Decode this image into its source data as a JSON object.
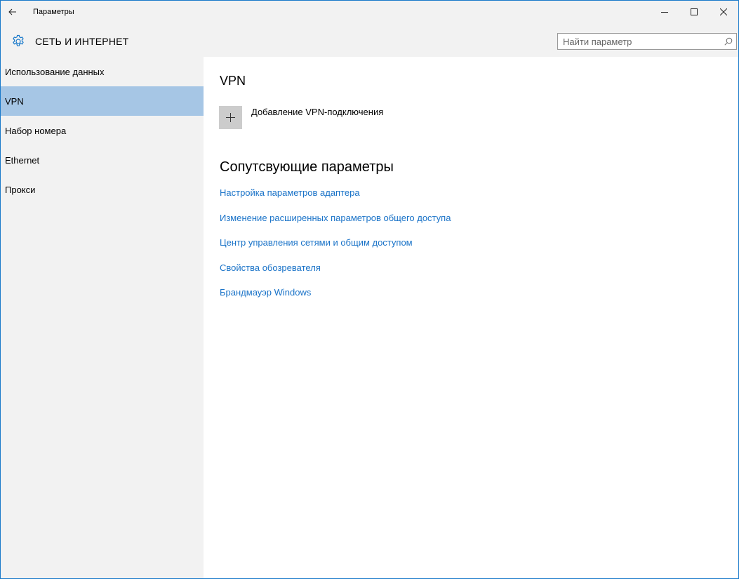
{
  "window": {
    "title": "Параметры"
  },
  "header": {
    "title": "СЕТЬ И ИНТЕРНЕТ",
    "icon": "gear-icon"
  },
  "search": {
    "value": "",
    "placeholder": "Найти параметр",
    "icon": "search-icon"
  },
  "sidebar": {
    "items": [
      {
        "label": "Использование данных",
        "selected": false
      },
      {
        "label": "VPN",
        "selected": true
      },
      {
        "label": "Набор номера",
        "selected": false
      },
      {
        "label": "Ethernet",
        "selected": false
      },
      {
        "label": "Прокси",
        "selected": false
      }
    ]
  },
  "main": {
    "section_title": "VPN",
    "add_vpn_label": "Добавление VPN-подключения",
    "related_title": "Сопутсвующие параметры",
    "links": [
      "Настройка параметров адаптера",
      "Изменение расширенных параметров общего доступа",
      "Центр управления сетями и общим доступом",
      "Свойства обозревателя",
      "Брандмауэр Windows"
    ]
  },
  "colors": {
    "accent_border": "#1979ca",
    "selected_item": "#a6c6e5",
    "link": "#1a73c8",
    "add_tile": "#cccccc",
    "sidebar_bg": "#f2f2f2",
    "content_bg": "#ffffff"
  }
}
